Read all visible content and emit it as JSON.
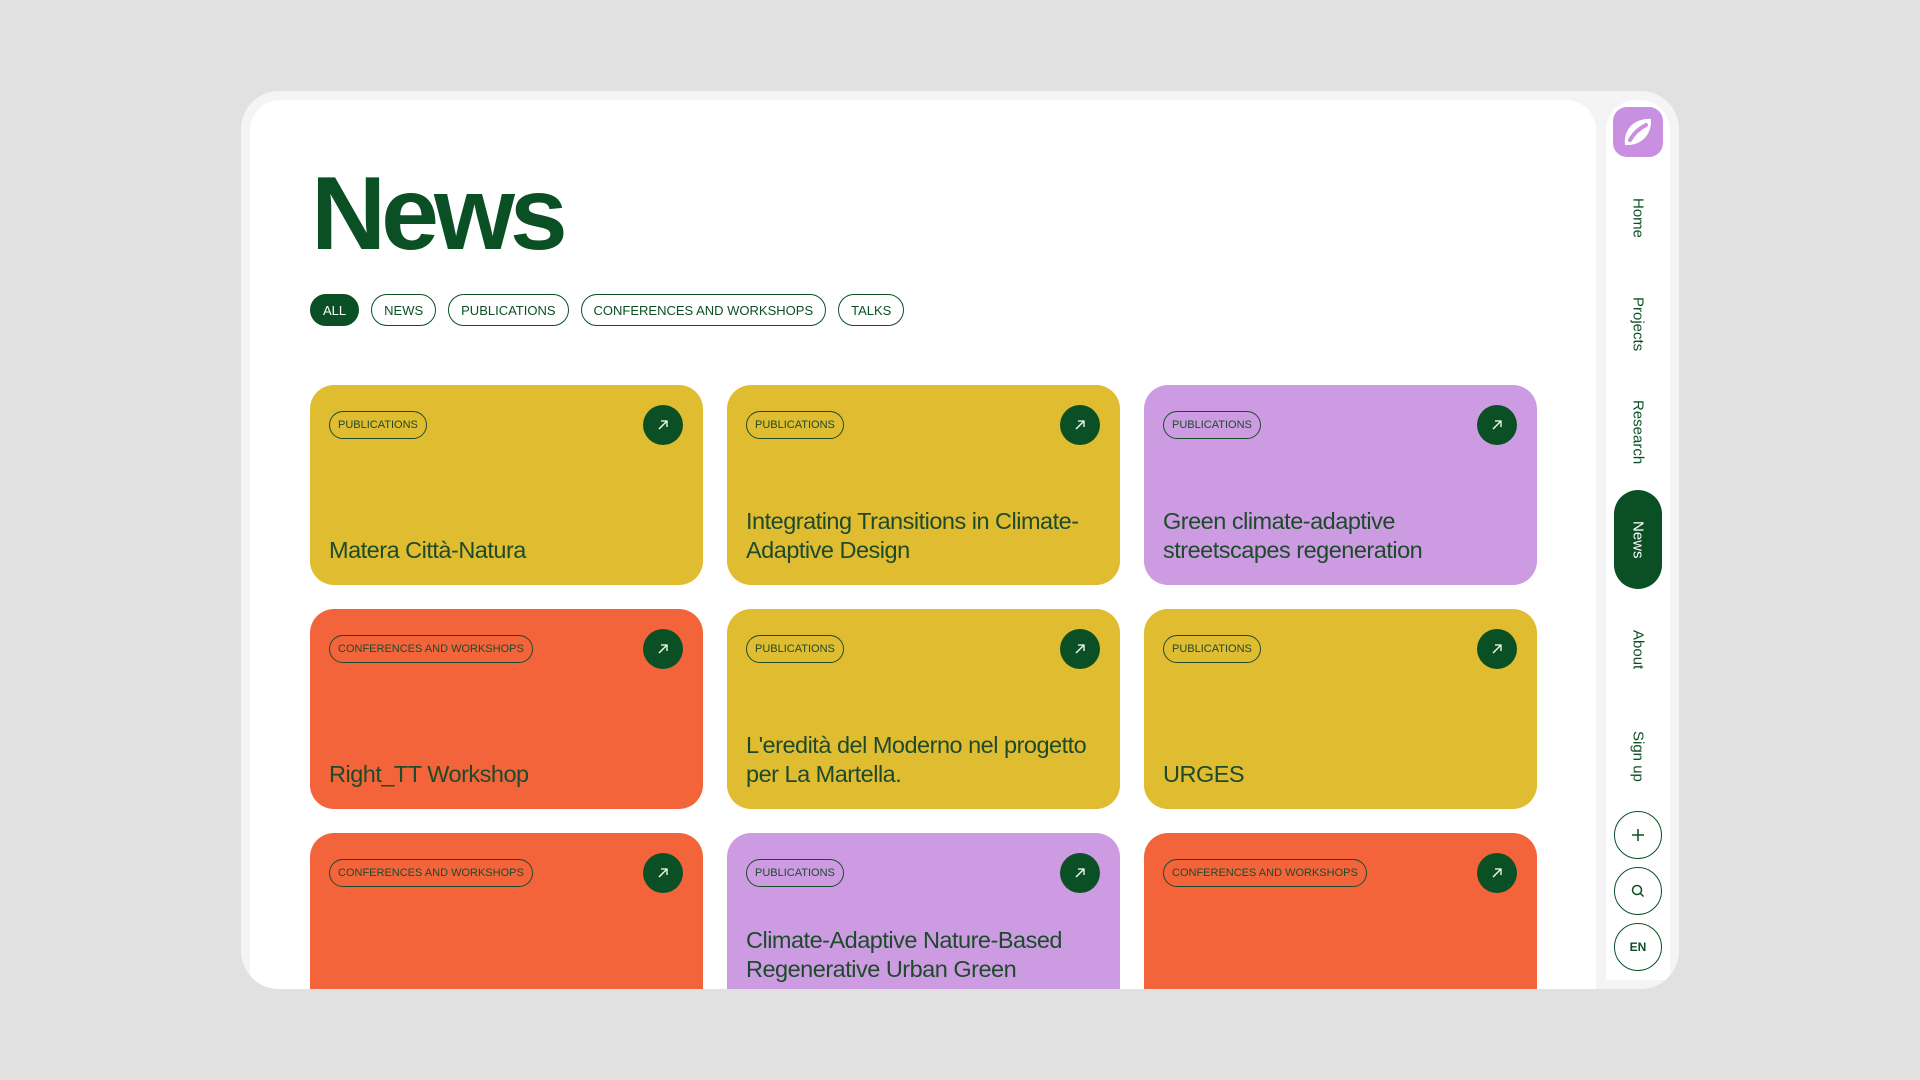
{
  "page": {
    "title": "News"
  },
  "filters": [
    {
      "label": "ALL",
      "active": true
    },
    {
      "label": "NEWS",
      "active": false
    },
    {
      "label": "PUBLICATIONS",
      "active": false
    },
    {
      "label": "CONFERENCES AND WORKSHOPS",
      "active": false
    },
    {
      "label": "TALKS",
      "active": false
    }
  ],
  "cards": [
    {
      "tag": "PUBLICATIONS",
      "title": "Matera Città-Natura",
      "color": "#e0bc31"
    },
    {
      "tag": "PUBLICATIONS",
      "title": "Integrating Transitions in Climate-Adaptive Design",
      "color": "#e0bc31"
    },
    {
      "tag": "PUBLICATIONS",
      "title": "Green climate-adaptive streetscapes regeneration",
      "color": "#cc9be1"
    },
    {
      "tag": "CONFERENCES AND WORKSHOPS",
      "title": "Right_TT Workshop",
      "color": "#f4643a"
    },
    {
      "tag": "PUBLICATIONS",
      "title": "L'eredità del Moderno nel progetto per La Martella.",
      "color": "#e0bc31"
    },
    {
      "tag": "PUBLICATIONS",
      "title": "URGES",
      "color": "#e0bc31"
    },
    {
      "tag": "CONFERENCES AND WORKSHOPS",
      "title": "",
      "color": "#f4643a"
    },
    {
      "tag": "PUBLICATIONS",
      "title": "Climate-Adaptive Nature-Based Regenerative Urban Green",
      "color": "#cc9be1"
    },
    {
      "tag": "CONFERENCES AND WORKSHOPS",
      "title": "",
      "color": "#f4643a"
    }
  ],
  "sidebar": {
    "logo_icon": "leaf-logo-icon",
    "nav": [
      {
        "label": "Home",
        "active": false
      },
      {
        "label": "Projects",
        "active": false
      },
      {
        "label": "Research",
        "active": false
      },
      {
        "label": "News",
        "active": true
      },
      {
        "label": "About",
        "active": false
      },
      {
        "label": "Sign up",
        "active": false
      }
    ],
    "buttons": {
      "plus_icon": "plus-icon",
      "search_icon": "search-icon",
      "language": "EN"
    }
  },
  "colors": {
    "brand_green": "#0b5025",
    "text_green": "#1e4a2c",
    "yellow": "#e0bc31",
    "purple": "#cc9be1",
    "orange": "#f4643a",
    "logo_purple": "#c98fe0"
  }
}
